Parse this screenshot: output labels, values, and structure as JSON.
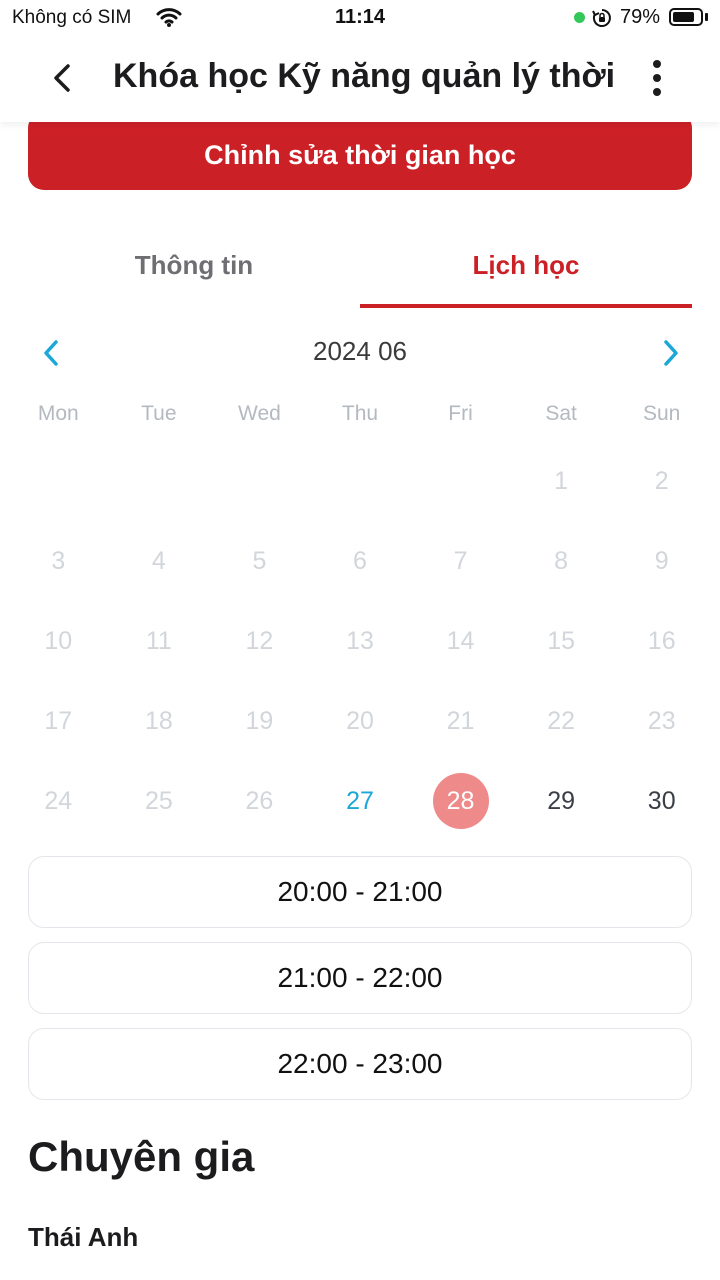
{
  "status_bar": {
    "carrier": "Không có SIM",
    "time": "11:14",
    "battery_text": "79%",
    "battery_level": 0.79
  },
  "header": {
    "title": "Khóa học Kỹ năng quản lý thời...",
    "back_icon": "chevron-left-icon",
    "more_icon": "more-vertical-icon"
  },
  "edit_button": {
    "label": "Chỉnh sửa thời gian học"
  },
  "tabs": [
    {
      "label": "Thông tin",
      "active": false
    },
    {
      "label": "Lịch học",
      "active": true
    }
  ],
  "calendar": {
    "month_label": "2024 06",
    "weekdays": [
      "Mon",
      "Tue",
      "Wed",
      "Thu",
      "Fri",
      "Sat",
      "Sun"
    ],
    "leading_blanks": 5,
    "days_in_month": 30,
    "today": 27,
    "selected": 28,
    "enabled_from": 27
  },
  "time_slots": [
    "20:00 - 21:00",
    "21:00 - 22:00",
    "22:00 - 23:00"
  ],
  "expert": {
    "heading": "Chuyên gia",
    "name": "Thái Anh"
  },
  "colors": {
    "accent": "#cc2027",
    "selected_day": "#ef8a8a",
    "today": "#1ba7d8",
    "nav_arrow": "#1ba7d8"
  }
}
